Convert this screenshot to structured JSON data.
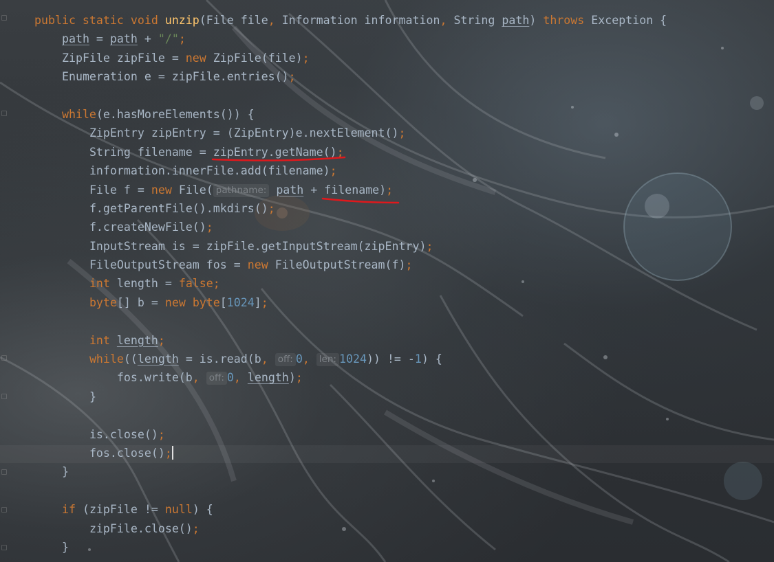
{
  "editor": {
    "lines": {
      "l1": {
        "t1": "public static void ",
        "t2": "unzip",
        "t3": "(File file",
        "t4": ", ",
        "t5": "Information information",
        "t6": ", ",
        "t7": "String ",
        "t8": "path",
        "t9": ") ",
        "t10": "throws ",
        "t11": "Exception {"
      },
      "l2": {
        "t1": "path",
        "t2": " = ",
        "t3": "path",
        "t4": " + ",
        "t5": "\"/\"",
        "t6": ";"
      },
      "l3": {
        "t1": "ZipFile zipFile = ",
        "t2": "new ",
        "t3": "ZipFile(file)",
        "t4": ";"
      },
      "l4": {
        "t1": "Enumeration e = zipFile.entries()",
        "t2": ";"
      },
      "l6": {
        "t1": "while",
        "t2": "(e.hasMoreElements()) {"
      },
      "l7": {
        "t1": "ZipEntry zipEntry = (ZipEntry)e.nextElement()",
        "t2": ";"
      },
      "l8": {
        "t1": "String filename = zipEntry.getName()",
        "t2": ";"
      },
      "l9": {
        "t1": "information.innerFile.add(filename)",
        "t2": ";"
      },
      "l10": {
        "t1": "File f = ",
        "t2": "new ",
        "t3": "File(",
        "hint": "pathname:",
        "t4": "path",
        "t5": " + filename)",
        "t6": ";"
      },
      "l11": {
        "t1": "f.getParentFile().mkdirs()",
        "t2": ";"
      },
      "l12": {
        "t1": "f.createNewFile()",
        "t2": ";"
      },
      "l13": {
        "t1": "InputStream is = zipFile.getInputStream(zipEntry)",
        "t2": ";"
      },
      "l14": {
        "t1": "FileOutputStream fos = ",
        "t2": "new ",
        "t3": "FileOutputStream(f)",
        "t4": ";"
      },
      "l15": {
        "t1": "int ",
        "t2": "length = ",
        "t3": "false",
        "t4": ";"
      },
      "l16": {
        "t1": "byte",
        "t2": "[] b = ",
        "t3": "new ",
        "t4": "byte",
        "t5": "[",
        "t6": "1024",
        "t7": "]",
        "t8": ";"
      },
      "l18": {
        "t1": "int ",
        "t2": "length",
        "t3": ";"
      },
      "l19": {
        "t1": "while",
        "t2": "((",
        "t3": "length",
        "t4": " = is.read(b",
        "t5": ", ",
        "hint1": "off:",
        "t6": "0",
        "t7": ", ",
        "hint2": "len:",
        "t8": "1024",
        "t9": ")) != -",
        "t10": "1",
        "t11": ") {"
      },
      "l20": {
        "t1": "fos.write(b",
        "t2": ", ",
        "hint": "off:",
        "t3": "0",
        "t4": ", ",
        "t5": "length",
        "t6": ")",
        "t7": ";"
      },
      "l21": {
        "t1": "}"
      },
      "l23": {
        "t1": "is.close()",
        "t2": ";"
      },
      "l24": {
        "t1": "fos.close()",
        "t2": ";"
      },
      "l25": {
        "t1": "}"
      },
      "l27": {
        "t1": "if ",
        "t2": "(zipFile != ",
        "t3": "null",
        "t4": ") {"
      },
      "l28": {
        "t1": "zipFile.close()",
        "t2": ";"
      },
      "l29": {
        "t1": "}"
      }
    }
  },
  "colors": {
    "keyword": "#cc7832",
    "method_decl": "#ffc66d",
    "number": "#6897bb",
    "string": "#6a8759",
    "text": "#a9b7c6",
    "annotation_underline": "#e0181c"
  }
}
